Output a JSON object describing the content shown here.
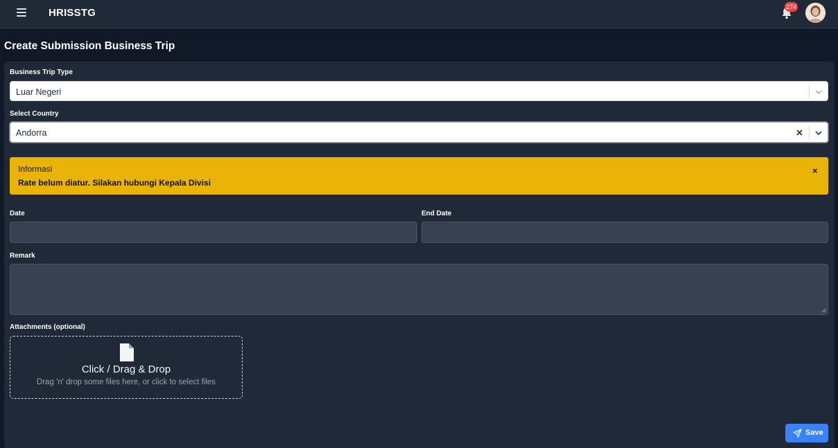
{
  "header": {
    "app_name": "HRISSTG",
    "notification_count": "274"
  },
  "page": {
    "title": "Create Submission Business Trip"
  },
  "form": {
    "trip_type": {
      "label": "Business Trip Type",
      "value": "Luar Negeri"
    },
    "country": {
      "label": "Select Country",
      "value": "Andorra"
    },
    "alert": {
      "title": "Informasi",
      "message": "Rate belum diatur. Silakan hubungi Kepala Divisi",
      "close": "×",
      "color": "#eab308"
    },
    "start_date": {
      "label": "Date",
      "value": ""
    },
    "end_date": {
      "label": "End Date",
      "value": ""
    },
    "remark": {
      "label": "Remark",
      "value": ""
    },
    "attachments": {
      "label": "Attachments (optional)",
      "title": "Click / Drag & Drop",
      "subtitle": "Drag 'n' drop some files here, or click to select files"
    },
    "save_label": "Save"
  },
  "icons": {
    "menu": "hamburger-icon",
    "notifications": "bell-icon",
    "file": "file-icon",
    "send": "paper-plane-icon",
    "clear": "x-icon",
    "dropdown": "chevron-down-icon"
  },
  "colors": {
    "background": "#111827",
    "surface": "#1f2937",
    "input": "#374151",
    "primary": "#3b82f6",
    "badge": "#ef4444"
  }
}
